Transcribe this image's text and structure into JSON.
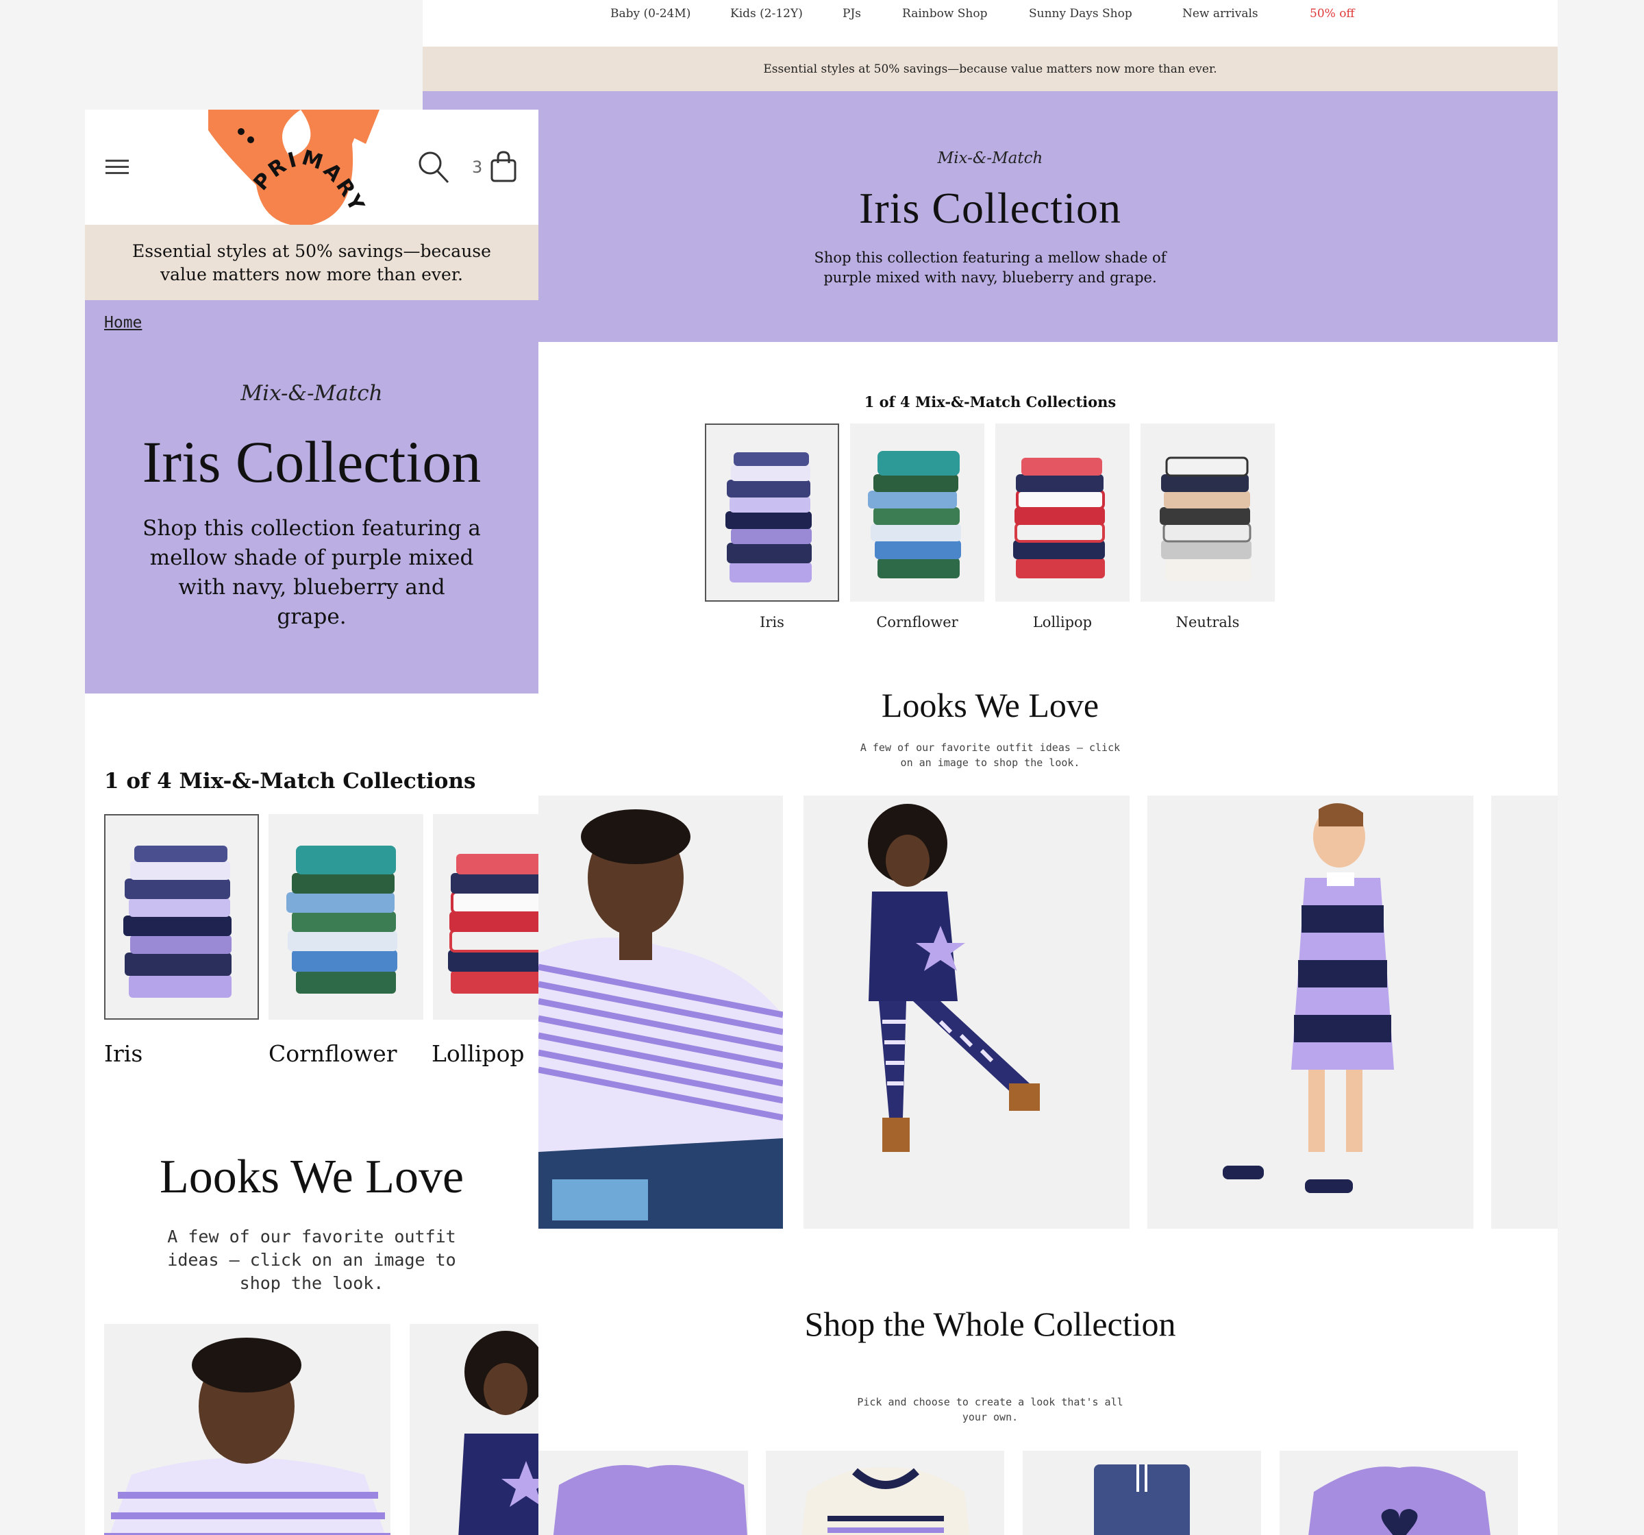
{
  "colors": {
    "hero_purple": "#baaee2",
    "promo_beige": "#ece1d6",
    "sale_red": "#e03a3a",
    "logo_orange": "#f5834b"
  },
  "desktop": {
    "nav": [
      {
        "label": "Baby (0-24M)"
      },
      {
        "label": "Kids (2-12Y)"
      },
      {
        "label": "PJs"
      },
      {
        "label": "Rainbow Shop"
      },
      {
        "label": "Sunny Days Shop"
      },
      {
        "label": "New arrivals"
      },
      {
        "label": "50% off"
      }
    ],
    "promo": "Essential styles at 50% savings—because value matters now more than ever.",
    "hero": {
      "kicker": "Mix-&-Match",
      "title": "Iris Collection",
      "description": "Shop this collection featuring a mellow shade of purple mixed with navy, blueberry and grape."
    },
    "collections": {
      "heading": "1 of 4 Mix-&-Match Collections",
      "items": [
        {
          "label": "Iris",
          "selected": true
        },
        {
          "label": "Cornflower",
          "selected": false
        },
        {
          "label": "Lollipop",
          "selected": false
        },
        {
          "label": "Neutrals",
          "selected": false
        }
      ]
    },
    "looks": {
      "title": "Looks We Love",
      "subtitle": "A few of our favorite outfit ideas — click on an image to shop the look."
    },
    "shop": {
      "title": "Shop the Whole Collection",
      "subtitle": "Pick and choose to create a look that's all your own."
    }
  },
  "mobile": {
    "logo": "PRIMARY",
    "cart_count": "3",
    "promo": "Essential styles at 50% savings—because value matters now more than ever.",
    "breadcrumb": "Home",
    "hero": {
      "kicker": "Mix-&-Match",
      "title": "Iris Collection",
      "description": "Shop this collection featuring a mellow shade of purple mixed with navy, blueberry and grape."
    },
    "collections": {
      "heading": "1 of 4 Mix-&-Match Collections",
      "items": [
        {
          "label": "Iris"
        },
        {
          "label": "Cornflower"
        },
        {
          "label": "Lollipop"
        }
      ]
    },
    "looks": {
      "title": "Looks We Love",
      "subtitle": "A few of our favorite outfit ideas — click on an image to shop the look."
    }
  }
}
